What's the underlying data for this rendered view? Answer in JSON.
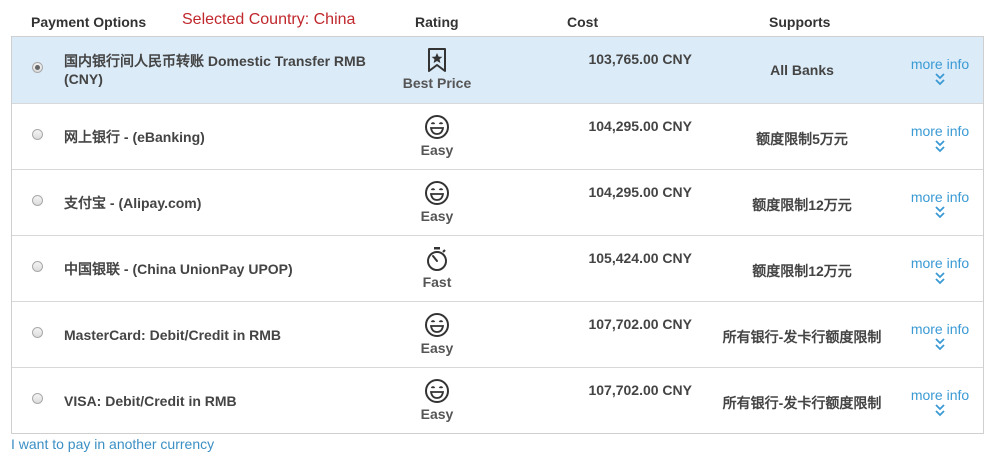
{
  "header": {
    "payment_options": "Payment Options",
    "selected_country": "Selected Country: China",
    "rating": "Rating",
    "cost": "Cost",
    "supports": "Supports"
  },
  "rows": [
    {
      "name": "国内银行间人民币转账 Domestic Transfer RMB (CNY)",
      "rating_icon": "bookmark-star-icon",
      "rating": "Best Price",
      "cost": "103,765.00 CNY",
      "supports": "All Banks",
      "more": "more info",
      "selected": true
    },
    {
      "name": "网上银行 - (eBanking)",
      "rating_icon": "smiley-icon",
      "rating": "Easy",
      "cost": "104,295.00 CNY",
      "supports": "额度限制5万元",
      "more": "more info",
      "selected": false
    },
    {
      "name": "支付宝 - (Alipay.com)",
      "rating_icon": "smiley-icon",
      "rating": "Easy",
      "cost": "104,295.00 CNY",
      "supports": "额度限制12万元",
      "more": "more info",
      "selected": false
    },
    {
      "name": "中国银联 - (China UnionPay UPOP)",
      "rating_icon": "stopwatch-icon",
      "rating": "Fast",
      "cost": "105,424.00 CNY",
      "supports": "额度限制12万元",
      "more": "more info",
      "selected": false
    },
    {
      "name": "MasterCard: Debit/Credit in RMB",
      "rating_icon": "smiley-icon",
      "rating": "Easy",
      "cost": "107,702.00 CNY",
      "supports": "所有银行-发卡行额度限制",
      "more": "more info",
      "selected": false
    },
    {
      "name": "VISA: Debit/Credit in RMB",
      "rating_icon": "smiley-icon",
      "rating": "Easy",
      "cost": "107,702.00 CNY",
      "supports": "所有银行-发卡行额度限制",
      "more": "more info",
      "selected": false
    }
  ],
  "footer": {
    "other_currency": "I want to pay in another currency"
  },
  "colors": {
    "selected_row": "#dbebf8",
    "link": "#3b9ad4",
    "country": "#c0282d"
  }
}
